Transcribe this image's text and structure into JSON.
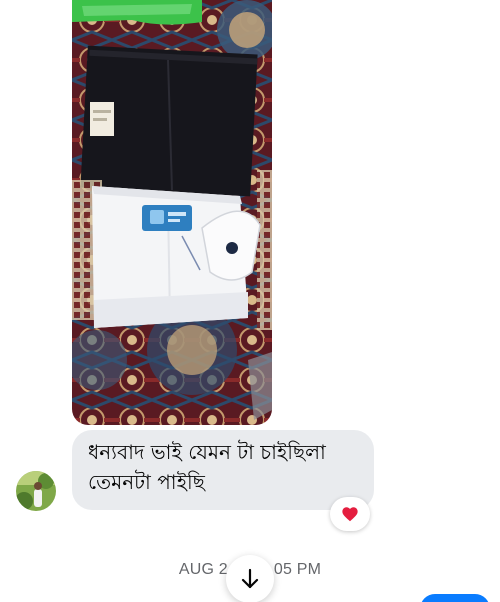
{
  "message": {
    "lines": [
      "ধন্যবাদ  ভাই যেমন টা চাইছিলা",
      "তেমনটা পাইছি"
    ]
  },
  "reaction": {
    "emoji": "heart-icon",
    "color": "#e41e3f"
  },
  "timestamp": {
    "left": "AUG 2",
    "right": "05 PM"
  },
  "colors": {
    "bubble": "#e9ebee",
    "timestamp": "#65676b",
    "accent": "#0a7cff"
  }
}
